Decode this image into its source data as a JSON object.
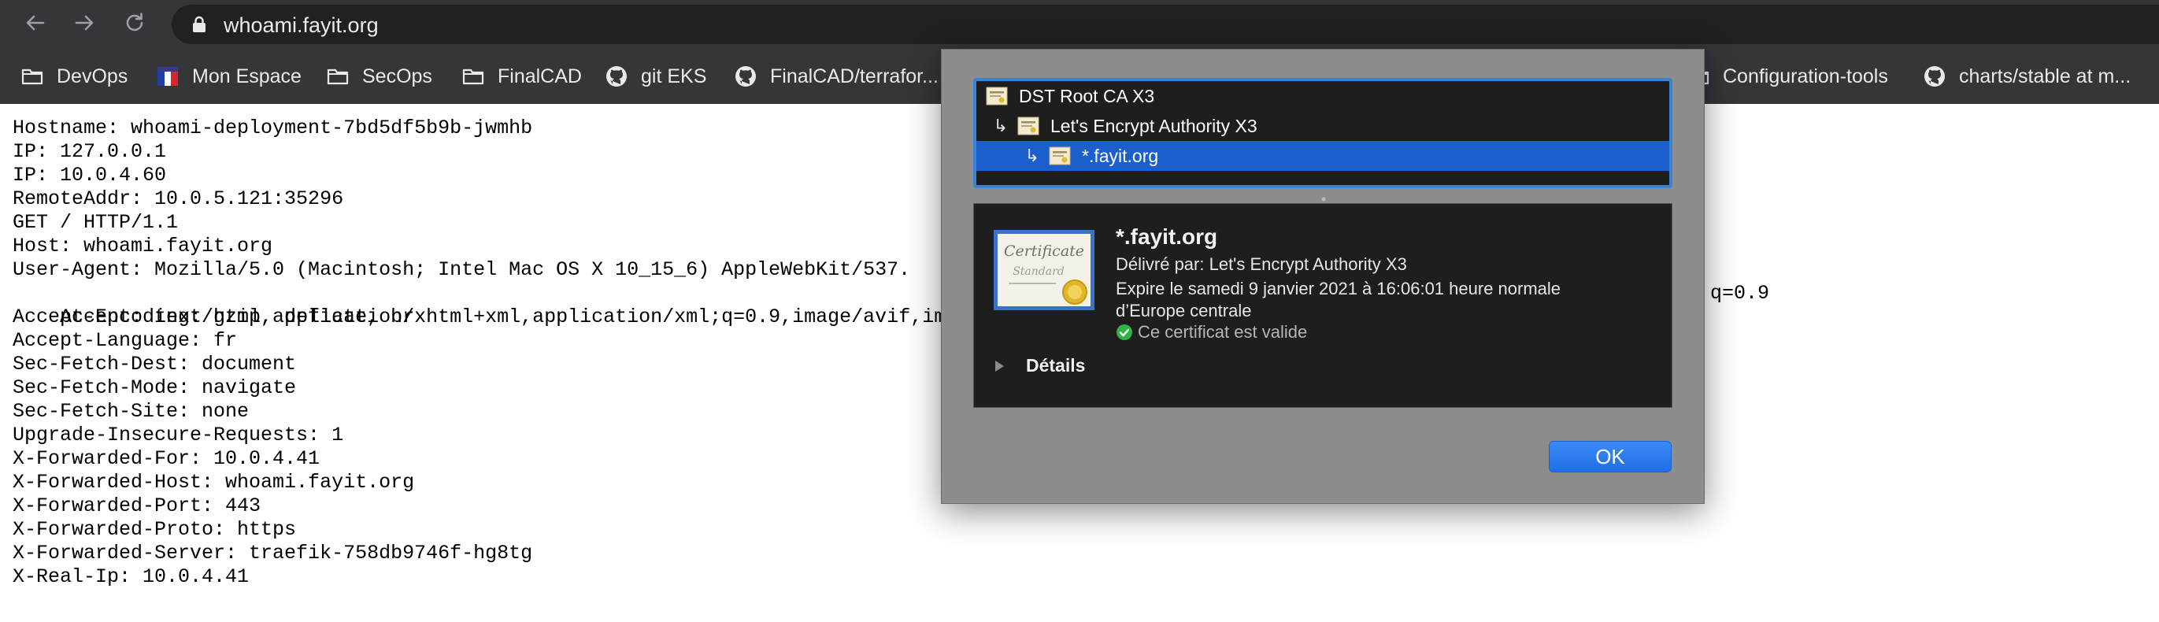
{
  "browser": {
    "url": "whoami.fayit.org",
    "nav_icons": [
      "back-icon",
      "forward-icon",
      "reload-icon",
      "lock-icon"
    ]
  },
  "bookmarks": [
    {
      "label": "DevOps",
      "icon": "folder-icon"
    },
    {
      "label": "Mon Espace",
      "icon": "flag-icon"
    },
    {
      "label": "SecOps",
      "icon": "folder-icon"
    },
    {
      "label": "FinalCAD",
      "icon": "folder-icon"
    },
    {
      "label": "git EKS",
      "icon": "github-icon"
    },
    {
      "label": "FinalCAD/terrafor...",
      "icon": "github-icon"
    },
    {
      "label": "Configuration-tools",
      "icon": "folder-icon"
    },
    {
      "label": "charts/stable at m...",
      "icon": "github-icon"
    }
  ],
  "content": {
    "lines": [
      "Hostname: whoami-deployment-7bd5df5b9b-jwmhb",
      "IP: 127.0.0.1",
      "IP: 10.0.4.60",
      "RemoteAddr: 10.0.5.121:35296",
      "GET / HTTP/1.1",
      "Host: whoami.fayit.org",
      "User-Agent: Mozilla/5.0 (Macintosh; Intel Mac OS X 10_15_6) AppleWebKit/537.",
      "Accept: text/html,application/xhtml+xml,application/xml;q=0.9,image/avif,ima",
      "Accept-Encoding: gzip, deflate, br",
      "Accept-Language: fr",
      "Sec-Fetch-Dest: document",
      "Sec-Fetch-Mode: navigate",
      "Sec-Fetch-Site: none",
      "Upgrade-Insecure-Requests: 1",
      "X-Forwarded-For: 10.0.4.41",
      "X-Forwarded-Host: whoami.fayit.org",
      "X-Forwarded-Port: 443",
      "X-Forwarded-Proto: https",
      "X-Forwarded-Server: traefik-758db9746f-hg8tg",
      "X-Real-Ip: 10.0.4.41"
    ],
    "accept_tail": "q=0.9"
  },
  "dialog": {
    "chain": [
      {
        "label": "DST Root CA X3",
        "arrow": "",
        "selected": false
      },
      {
        "label": "Let's Encrypt Authority X3",
        "arrow": "↳",
        "selected": false
      },
      {
        "label": "*.fayit.org",
        "arrow": "↳",
        "selected": true
      }
    ],
    "cert": {
      "name": "*.fayit.org",
      "issuer": "Délivré par: Let's Encrypt Authority X3",
      "expiry": "Expire le samedi 9 janvier 2021 à 16:06:01 heure normale d’Europe centrale",
      "valid": "Ce certificat est valide"
    },
    "details_label": "Détails",
    "ok_label": "OK",
    "colors": {
      "selection": "#1b5fcc",
      "focus_ring": "#3a82d4",
      "ok_button": "#2a7cf0",
      "valid_green": "#2fb344"
    }
  }
}
